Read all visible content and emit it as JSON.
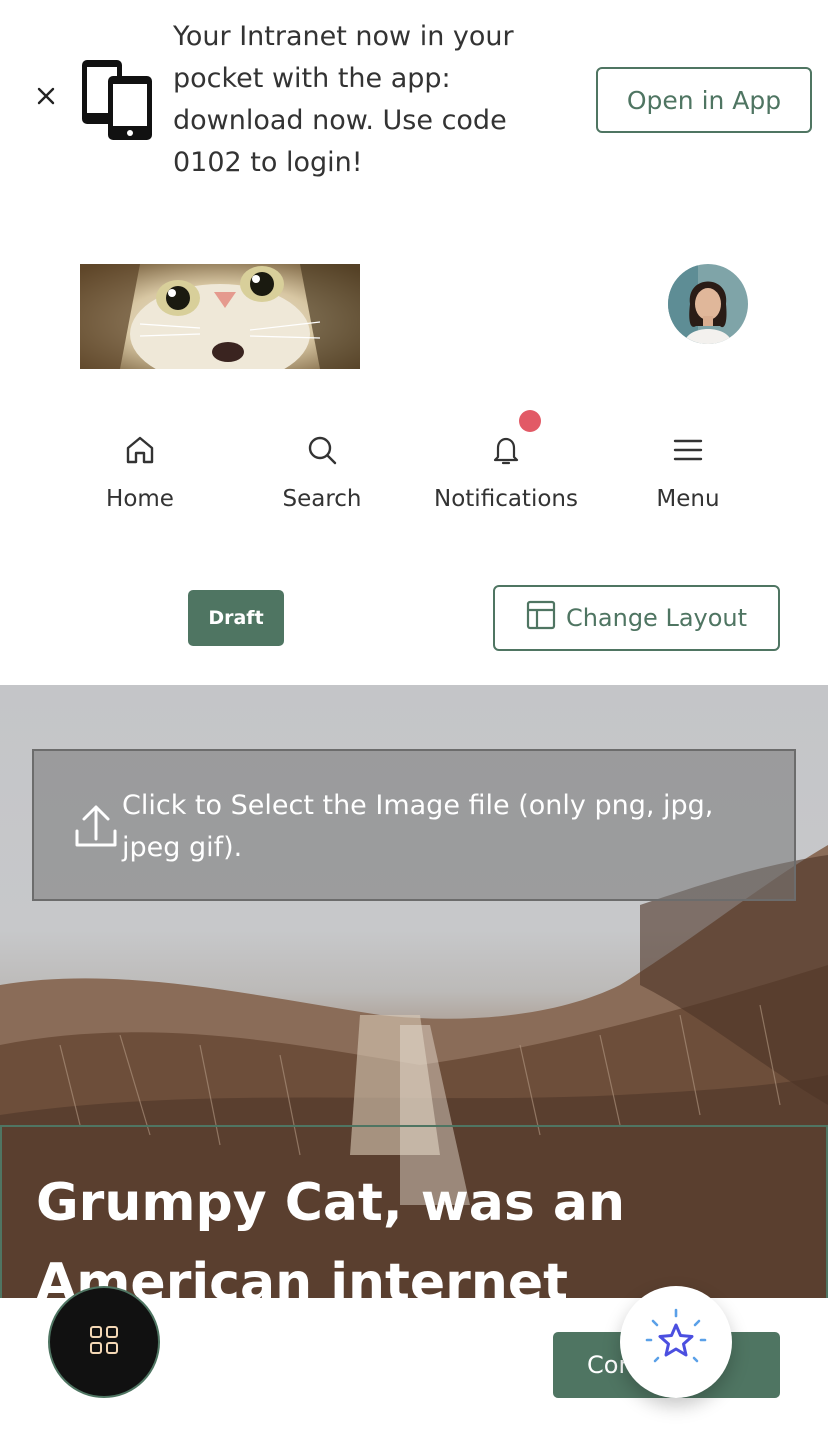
{
  "banner": {
    "close_icon": "close-icon",
    "device_icon": "devices-icon",
    "message": "Your Intranet now in your pocket with the app: download now. Use code 0102 to login!",
    "open_app_label": "Open in App"
  },
  "header": {
    "logo": "cat-face-image",
    "avatar": "user-avatar-photo"
  },
  "nav": {
    "items": [
      {
        "label": "Home",
        "icon": "home-icon"
      },
      {
        "label": "Search",
        "icon": "search-icon"
      },
      {
        "label": "Notifications",
        "icon": "bell-icon",
        "has_unread": true
      },
      {
        "label": "Menu",
        "icon": "hamburger-icon"
      }
    ]
  },
  "toolbar": {
    "status_badge": "Draft",
    "change_layout_label": "Change Layout",
    "change_layout_icon": "layout-icon"
  },
  "hero": {
    "upload_prompt": "Click to Select the Image file (only png, jpg, jpeg gif).",
    "upload_icon": "upload-icon",
    "title": "Grumpy Cat, was an American internet"
  },
  "footer": {
    "apps_icon": "grid-icon",
    "continue_label": "Continue",
    "ai_icon": "sparkle-star-icon"
  },
  "colors": {
    "accent": "#4f7562",
    "notification_dot": "#e25a66",
    "ai_star": "#4b4fe0"
  }
}
